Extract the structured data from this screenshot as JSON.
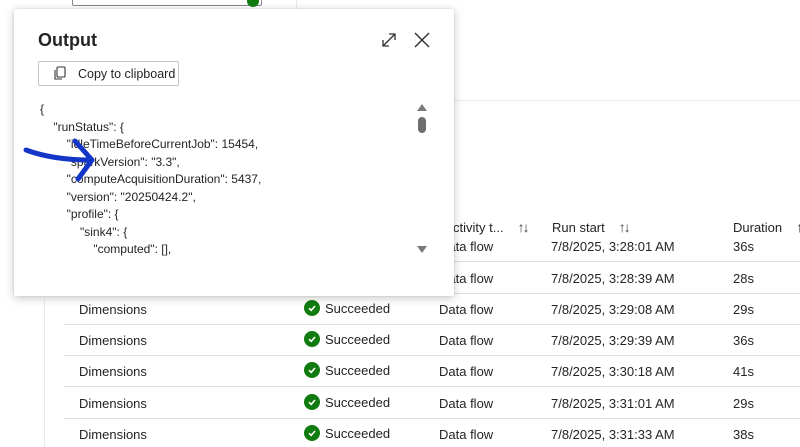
{
  "panel": {
    "title": "Output",
    "copy_label": "Copy to clipboard",
    "expand_icon": "expand-icon",
    "close_icon": "close-icon",
    "code_lines": [
      "{",
      "    \"runStatus\": {",
      "        \"idleTimeBeforeCurrentJob\": 15454,",
      "        \"sparkVersion\": \"3.3\",",
      "        \"computeAcquisitionDuration\": 5437,",
      "        \"version\": \"20250424.2\",",
      "        \"profile\": {",
      "            \"sink4\": {",
      "                \"computed\": [],"
    ]
  },
  "grid": {
    "columns": {
      "activity_type": "ctivity t...",
      "run_start": "Run start",
      "duration": "Duration"
    },
    "rows": [
      {
        "name": "",
        "status": "",
        "type": "Data flow",
        "start": "7/8/2025, 3:28:01 AM",
        "duration": "36s"
      },
      {
        "name": "",
        "status": "",
        "type": "Data flow",
        "start": "7/8/2025, 3:28:39 AM",
        "duration": "28s"
      },
      {
        "name": "Dimensions",
        "status": "Succeeded",
        "type": "Data flow",
        "start": "7/8/2025, 3:29:08 AM",
        "duration": "29s"
      },
      {
        "name": "Dimensions",
        "status": "Succeeded",
        "type": "Data flow",
        "start": "7/8/2025, 3:29:39 AM",
        "duration": "36s"
      },
      {
        "name": "Dimensions",
        "status": "Succeeded",
        "type": "Data flow",
        "start": "7/8/2025, 3:30:18 AM",
        "duration": "41s"
      },
      {
        "name": "Dimensions",
        "status": "Succeeded",
        "type": "Data flow",
        "start": "7/8/2025, 3:31:01 AM",
        "duration": "29s"
      },
      {
        "name": "Dimensions",
        "status": "Succeeded",
        "type": "Data flow",
        "start": "7/8/2025, 3:31:33 AM",
        "duration": "38s"
      }
    ]
  },
  "colors": {
    "success": "#107c10",
    "annotation": "#1336c9"
  }
}
